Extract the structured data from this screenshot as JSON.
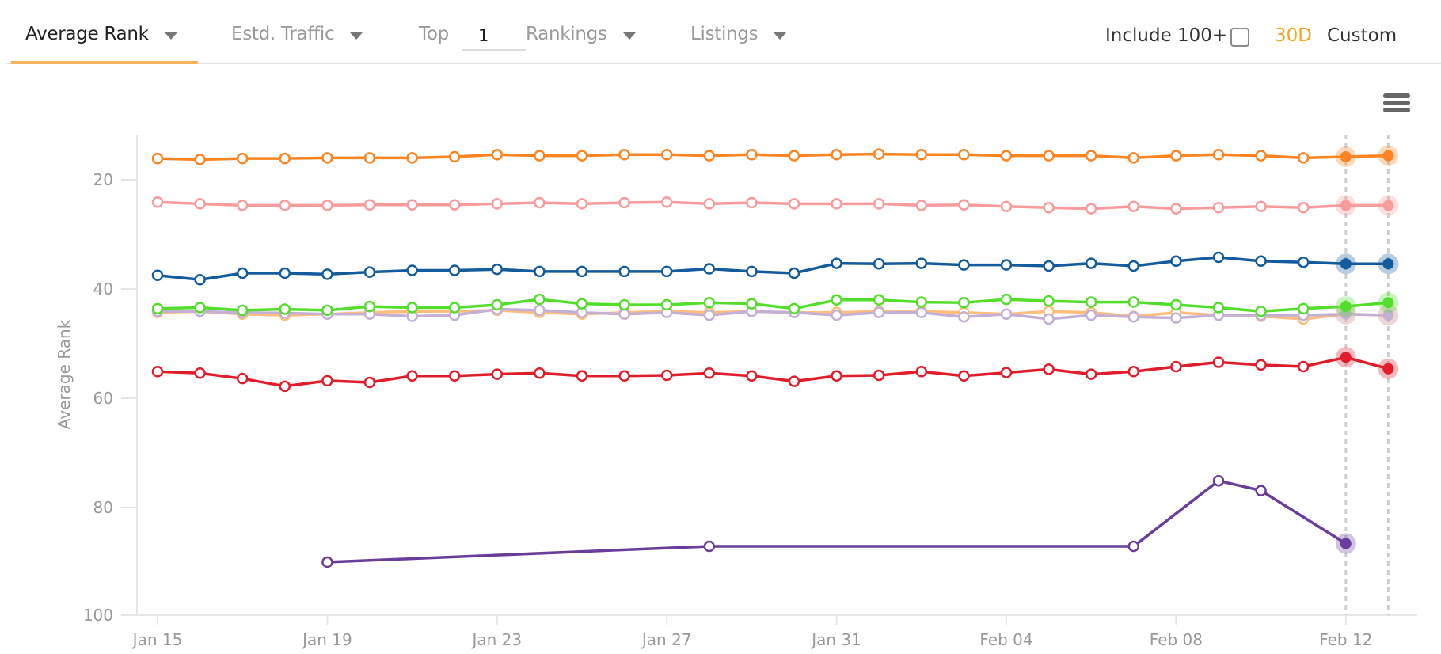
{
  "toolbar": {
    "tabs": [
      {
        "label": "Average Rank",
        "active": true
      },
      {
        "label": "Estd. Traffic",
        "active": false
      },
      {
        "label": "Top",
        "active": false
      },
      {
        "label": "Rankings",
        "active": false
      },
      {
        "label": "Listings",
        "active": false
      }
    ],
    "top_value": "1",
    "include_label": "Include 100+",
    "include_checked": false,
    "range_30d": "30D",
    "range_custom": "Custom",
    "accent_color": "#f7a325"
  },
  "chart_data": {
    "type": "line",
    "title": "",
    "xlabel": "",
    "ylabel": "Average Rank",
    "y_inverted": true,
    "ylim": [
      10,
      100
    ],
    "yticks": [
      20,
      40,
      60,
      80,
      100
    ],
    "x": [
      "Jan 15",
      "Jan 16",
      "Jan 17",
      "Jan 18",
      "Jan 19",
      "Jan 20",
      "Jan 21",
      "Jan 22",
      "Jan 23",
      "Jan 24",
      "Jan 25",
      "Jan 26",
      "Jan 27",
      "Jan 28",
      "Jan 29",
      "Jan 30",
      "Jan 31",
      "Feb 01",
      "Feb 02",
      "Feb 03",
      "Feb 04",
      "Feb 05",
      "Feb 06",
      "Feb 07",
      "Feb 08",
      "Feb 09",
      "Feb 10",
      "Feb 11",
      "Feb 12",
      "Feb 13"
    ],
    "xtick_labels": [
      "Jan 15",
      "Jan 19",
      "Jan 23",
      "Jan 27",
      "Jan 31",
      "Feb 04",
      "Feb 08",
      "Feb 12"
    ],
    "xtick_index": [
      0,
      4,
      8,
      12,
      16,
      20,
      24,
      28
    ],
    "highlighted_index": [
      28,
      29
    ],
    "grid": false,
    "legend": "none",
    "series": [
      {
        "name": "orange",
        "color": "#fd8421",
        "values": [
          16.1,
          16.3,
          16.1,
          16.1,
          16.0,
          16.0,
          16.0,
          15.8,
          15.4,
          15.6,
          15.6,
          15.4,
          15.4,
          15.6,
          15.4,
          15.6,
          15.4,
          15.3,
          15.4,
          15.4,
          15.6,
          15.6,
          15.6,
          16.0,
          15.6,
          15.4,
          15.6,
          16.0,
          15.8,
          15.6
        ]
      },
      {
        "name": "pink",
        "color": "#f99b9d",
        "values": [
          24.1,
          24.4,
          24.7,
          24.7,
          24.7,
          24.6,
          24.6,
          24.6,
          24.4,
          24.2,
          24.4,
          24.2,
          24.1,
          24.4,
          24.2,
          24.4,
          24.4,
          24.4,
          24.7,
          24.6,
          24.9,
          25.1,
          25.3,
          24.9,
          25.3,
          25.1,
          24.9,
          25.1,
          24.7,
          24.7
        ]
      },
      {
        "name": "blue",
        "color": "#135b9d",
        "values": [
          37.5,
          38.3,
          37.1,
          37.1,
          37.3,
          36.9,
          36.6,
          36.6,
          36.4,
          36.8,
          36.8,
          36.8,
          36.8,
          36.3,
          36.8,
          37.1,
          35.3,
          35.4,
          35.3,
          35.6,
          35.6,
          35.8,
          35.3,
          35.8,
          34.9,
          34.2,
          34.9,
          35.1,
          35.4,
          35.4
        ]
      },
      {
        "name": "light-orange",
        "color": "#fdbd7d",
        "values": [
          44.3,
          44.1,
          44.6,
          44.8,
          44.6,
          44.3,
          44.1,
          44.1,
          43.9,
          44.3,
          44.6,
          44.3,
          44.1,
          44.3,
          44.1,
          44.3,
          44.3,
          44.1,
          44.1,
          44.3,
          44.6,
          44.1,
          44.3,
          45.0,
          44.3,
          44.8,
          45.0,
          45.5,
          44.6,
          44.8
        ]
      },
      {
        "name": "light-purple",
        "color": "#c5b0d5",
        "values": [
          44.1,
          44.1,
          44.3,
          44.4,
          44.6,
          44.6,
          45.0,
          44.8,
          43.7,
          43.9,
          44.3,
          44.6,
          44.3,
          44.8,
          44.1,
          44.3,
          44.8,
          44.3,
          44.3,
          45.1,
          44.6,
          45.5,
          44.8,
          45.1,
          45.3,
          44.8,
          44.8,
          44.8,
          44.6,
          44.8
        ]
      },
      {
        "name": "green",
        "color": "#54de2c",
        "values": [
          43.6,
          43.4,
          43.9,
          43.7,
          43.9,
          43.2,
          43.4,
          43.4,
          42.9,
          41.9,
          42.7,
          42.9,
          42.9,
          42.5,
          42.7,
          43.6,
          42.0,
          42.0,
          42.4,
          42.5,
          41.9,
          42.2,
          42.4,
          42.4,
          42.9,
          43.4,
          44.1,
          43.6,
          43.2,
          42.5
        ]
      },
      {
        "name": "red",
        "color": "#e11d2b",
        "values": [
          55.1,
          55.4,
          56.4,
          57.8,
          56.8,
          57.1,
          55.9,
          55.9,
          55.6,
          55.4,
          55.9,
          55.9,
          55.8,
          55.4,
          55.9,
          56.9,
          55.9,
          55.8,
          55.1,
          55.9,
          55.3,
          54.7,
          55.6,
          55.1,
          54.2,
          53.4,
          53.9,
          54.2,
          52.5,
          54.6
        ]
      },
      {
        "name": "purple",
        "color": "#6a3d9a",
        "values": [
          null,
          null,
          null,
          null,
          90.0,
          null,
          null,
          null,
          null,
          null,
          null,
          null,
          null,
          87.1,
          null,
          null,
          null,
          null,
          null,
          null,
          null,
          null,
          null,
          87.1,
          null,
          75.1,
          76.9,
          null,
          86.6,
          null
        ]
      }
    ]
  }
}
